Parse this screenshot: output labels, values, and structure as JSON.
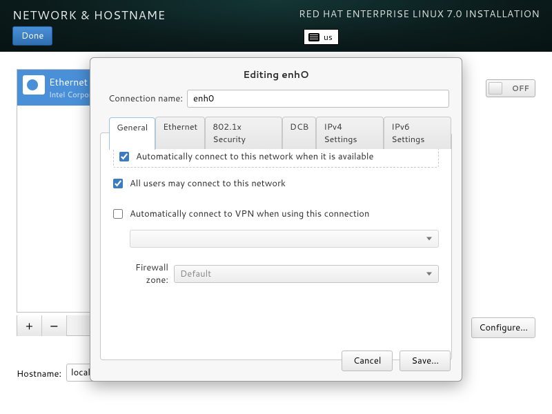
{
  "topbar": {
    "title": "NETWORK & HOSTNAME",
    "subtitle": "RED HAT ENTERPRISE LINUX 7.0 INSTALLATION",
    "done_label": "Done",
    "keyboard_layout": "us"
  },
  "netlist": {
    "items": [
      {
        "name": "Ethernet",
        "subtitle": "Intel Corporation"
      }
    ]
  },
  "toggle": {
    "state_label": "OFF"
  },
  "configure_label": "Configure...",
  "hostname": {
    "label": "Hostname:",
    "value": "local"
  },
  "plus_label": "+",
  "minus_label": "−",
  "dialog": {
    "title": "Editing enhO",
    "connection_name_label": "Connection name:",
    "connection_name_value": "enh0",
    "tabs": [
      "General",
      "Ethernet",
      "802.1x Security",
      "DCB",
      "IPv4 Settings",
      "IPv6 Settings"
    ],
    "active_tab": 0,
    "general": {
      "auto_connect_label": "Automatically connect to this network when it is available",
      "auto_connect_checked": true,
      "all_users_label": "All users may connect to this network",
      "all_users_checked": true,
      "auto_vpn_label": "Automatically connect to VPN when using this connection",
      "auto_vpn_checked": false,
      "vpn_select_value": "",
      "firewall_zone_label": "Firewall zone:",
      "firewall_zone_value": "Default"
    },
    "buttons": {
      "cancel": "Cancel",
      "save": "Save..."
    }
  }
}
